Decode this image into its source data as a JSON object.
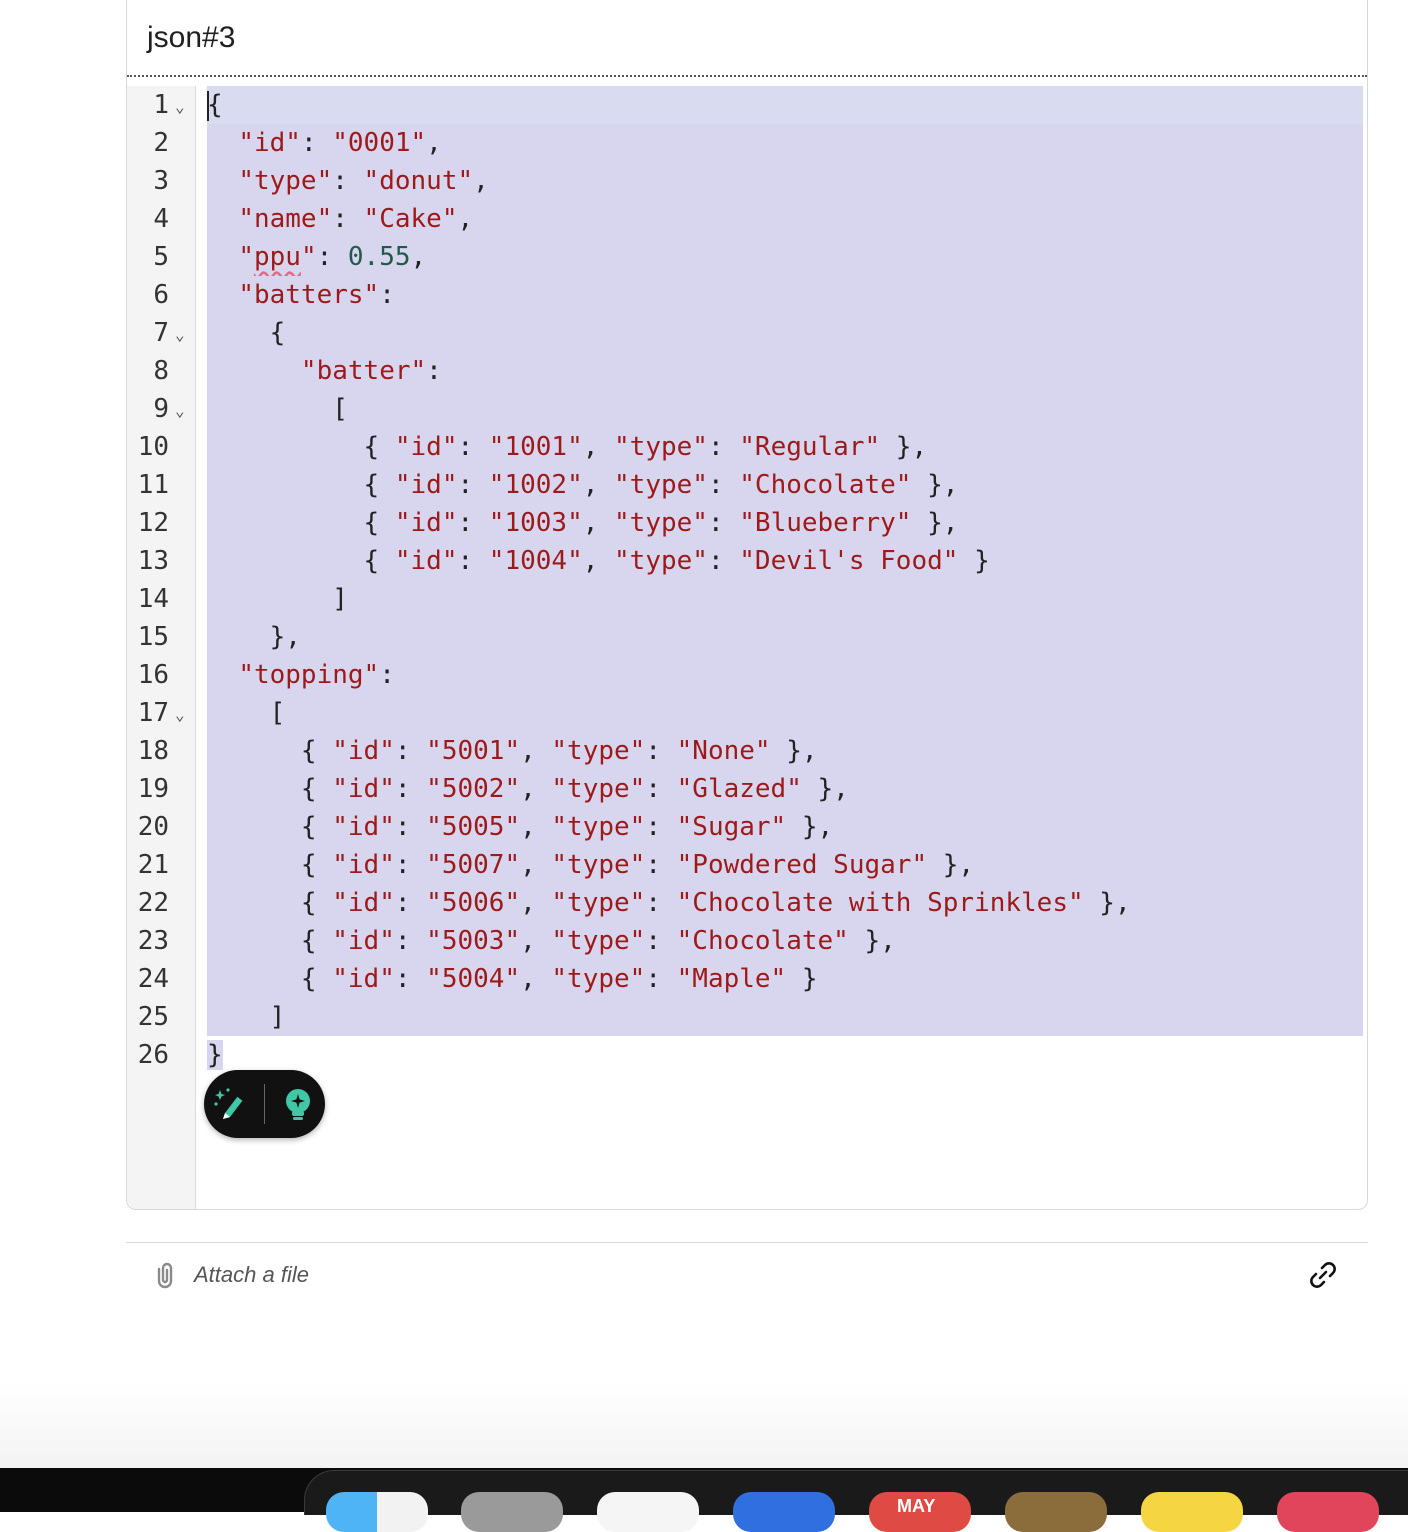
{
  "card": {
    "title": "json#3"
  },
  "editor": {
    "lines": [
      {
        "num": "1",
        "fold": true
      },
      {
        "num": "2",
        "fold": false
      },
      {
        "num": "3",
        "fold": false
      },
      {
        "num": "4",
        "fold": false
      },
      {
        "num": "5",
        "fold": false
      },
      {
        "num": "6",
        "fold": false
      },
      {
        "num": "7",
        "fold": true
      },
      {
        "num": "8",
        "fold": false
      },
      {
        "num": "9",
        "fold": true
      },
      {
        "num": "10",
        "fold": false
      },
      {
        "num": "11",
        "fold": false
      },
      {
        "num": "12",
        "fold": false
      },
      {
        "num": "13",
        "fold": false
      },
      {
        "num": "14",
        "fold": false
      },
      {
        "num": "15",
        "fold": false
      },
      {
        "num": "16",
        "fold": false
      },
      {
        "num": "17",
        "fold": true
      },
      {
        "num": "18",
        "fold": false
      },
      {
        "num": "19",
        "fold": false
      },
      {
        "num": "20",
        "fold": false
      },
      {
        "num": "21",
        "fold": false
      },
      {
        "num": "22",
        "fold": false
      },
      {
        "num": "23",
        "fold": false
      },
      {
        "num": "24",
        "fold": false
      },
      {
        "num": "25",
        "fold": false
      },
      {
        "num": "26",
        "fold": false
      }
    ],
    "fold_glyph": "⌄",
    "tokens": {
      "id": "\"id\"",
      "type": "\"type\"",
      "name": "\"name\"",
      "ppu_open": "\"",
      "ppu_word": "ppu",
      "ppu_close": "\"",
      "batters": "\"batters\"",
      "batter": "\"batter\"",
      "topping": "\"topping\"",
      "v0001": "\"0001\"",
      "vdonut": "\"donut\"",
      "vcake": "\"Cake\"",
      "vppu": "0.55",
      "v1001": "\"1001\"",
      "v1002": "\"1002\"",
      "v1003": "\"1003\"",
      "v1004": "\"1004\"",
      "vRegular": "\"Regular\"",
      "vChocolate": "\"Chocolate\"",
      "vBlueberry": "\"Blueberry\"",
      "vDevils": "\"Devil's Food\"",
      "v5001": "\"5001\"",
      "v5002": "\"5002\"",
      "v5005": "\"5005\"",
      "v5007": "\"5007\"",
      "v5006": "\"5006\"",
      "v5003": "\"5003\"",
      "v5004": "\"5004\"",
      "vNone": "\"None\"",
      "vGlazed": "\"Glazed\"",
      "vSugar": "\"Sugar\"",
      "vPowdered": "\"Powdered Sugar\"",
      "vChocSprinkles": "\"Chocolate with Sprinkles\"",
      "vMaple": "\"Maple\""
    }
  },
  "footer": {
    "attach_label": "Attach a file"
  },
  "dock": {
    "calendar_label": "MAY"
  },
  "icons": {
    "ai_edit": "sparkle-pencil-icon",
    "ai_hint": "lightbulb-icon",
    "attach": "paperclip-icon",
    "link": "link-icon"
  },
  "colors": {
    "selection": "#d8d6ee",
    "string": "#9d1a1a",
    "number": "#1f5a4a",
    "toolbar_bg": "#111111",
    "accent_teal": "#3fc7a6"
  }
}
